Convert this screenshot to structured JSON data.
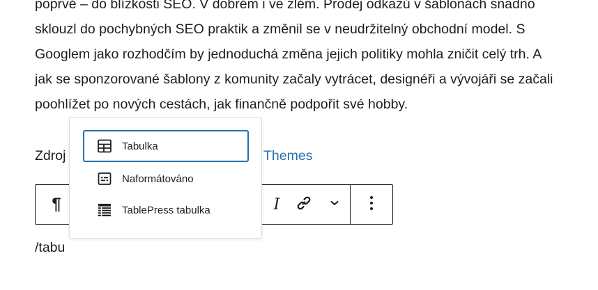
{
  "paragraph": {
    "lines": [
      "poprvé – do blízkosti SEO. V dobrém i ve zlém. Prodej odkazů v šablonách snadno",
      "sklouzl do pochybných SEO praktik a změnil se v neudržitelný obchodní model. S",
      "Googlem jako rozhodčím by jednoduchá změna jejich politiky mohla zničit celý trh. A",
      "jak se sponzorované šablony z komunity začaly vytrácet, designéři a vývojáři se začali",
      "poohlížet po nových cestách, jak finančně podpořit své hobby."
    ]
  },
  "source": {
    "prefix": "Zdroj",
    "link_text": "Themes"
  },
  "toolbar": {
    "paragraph_icon": "pilcrow-icon",
    "paragraph_glyph": "¶",
    "italic_label": "I",
    "link_icon": "link-icon",
    "more_icon": "chevron-down-icon",
    "options_icon": "more-vertical-icon"
  },
  "editor": {
    "typed_text": "/tabu"
  },
  "autocomplete": {
    "items": [
      {
        "label": "Tabulka",
        "icon": "table-icon",
        "selected": true
      },
      {
        "label": "Naformátováno",
        "icon": "preformatted-icon",
        "selected": false
      },
      {
        "label": "TablePress tabulka",
        "icon": "tablepress-icon",
        "selected": false
      }
    ]
  },
  "colors": {
    "text": "#1e1e1e",
    "link": "#2271b1",
    "selected_border": "#2271b1",
    "popover_border": "#dcdcde"
  }
}
